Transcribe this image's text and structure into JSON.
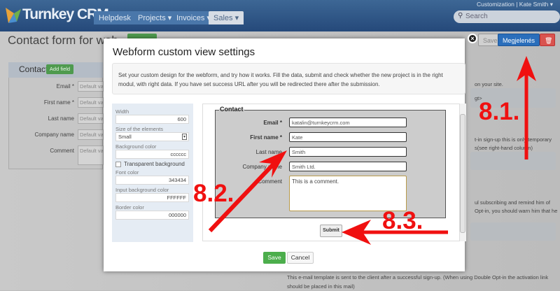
{
  "header": {
    "brand": "Turnkey CRM",
    "tabs": [
      "Helpdesk ▾",
      "Projects ▾",
      "Invoices ▾",
      "Sales ▾"
    ],
    "active_tab": "Sales",
    "topright": "Customization  |  Kate Smith ▾",
    "search_placeholder": "Search"
  },
  "page": {
    "title": "Contact form for web",
    "save": "Save",
    "appearance": "Megjelenés",
    "contact_heading": "Contact",
    "add_field": "Add field",
    "fields": [
      {
        "label": "Email *",
        "placeholder": "Default value"
      },
      {
        "label": "First name *",
        "placeholder": "Default value"
      },
      {
        "label": "Last name",
        "placeholder": "Default value"
      },
      {
        "label": "Company name",
        "placeholder": "Default value"
      },
      {
        "label": "Comment",
        "placeholder": "Default value"
      }
    ],
    "right_texts": [
      "on your site.",
      "gt>",
      "t-in sign-up this is only temporary",
      "s(see right-hand column)",
      "ul subscribing and remind him of",
      "Opt-in, you should warn him that he"
    ],
    "bottom_text": "This e-mail template is sent to the client after a successful sign-up. (When using Double Opt-in the activation link should be placed in this mail)"
  },
  "modal": {
    "title": "Webform custom view settings",
    "info": "Set your custom design for the webform, and try how it works. Fill the data, submit and check whether the new project is in the right modul, with right data. If you have set success URL after you will be redirected there after the submission.",
    "settings": {
      "width_label": "Width",
      "width": "600",
      "size_label": "Size of the elements",
      "size": "Small",
      "bg_label": "Background color",
      "bg": "cccccc",
      "transparent_label": "Transparent background",
      "transparent": false,
      "font_label": "Font color",
      "font": "343434",
      "input_bg_label": "Input background color",
      "input_bg": "FFFFFF",
      "border_label": "Border color",
      "border": "000000"
    },
    "preview": {
      "legend": "Contact",
      "fields": [
        {
          "label": "Email *",
          "value": "katalin@turnkeycrm.com"
        },
        {
          "label": "First name *",
          "value": "Kate"
        },
        {
          "label": "Last name",
          "value": "Smith"
        },
        {
          "label": "Company name",
          "value": "Smith Ltd."
        },
        {
          "label": "Comment",
          "value": "This is a comment."
        }
      ],
      "submit": "Submit"
    },
    "save": "Save",
    "cancel": "Cancel"
  },
  "annotations": [
    "8.1.",
    "8.2.",
    "8.3."
  ],
  "colors": {
    "header": "#2f5a8a",
    "arrow": "#f01010",
    "save_green": "#4cae4c",
    "primary": "#2a6ebb",
    "danger": "#d9534f"
  }
}
